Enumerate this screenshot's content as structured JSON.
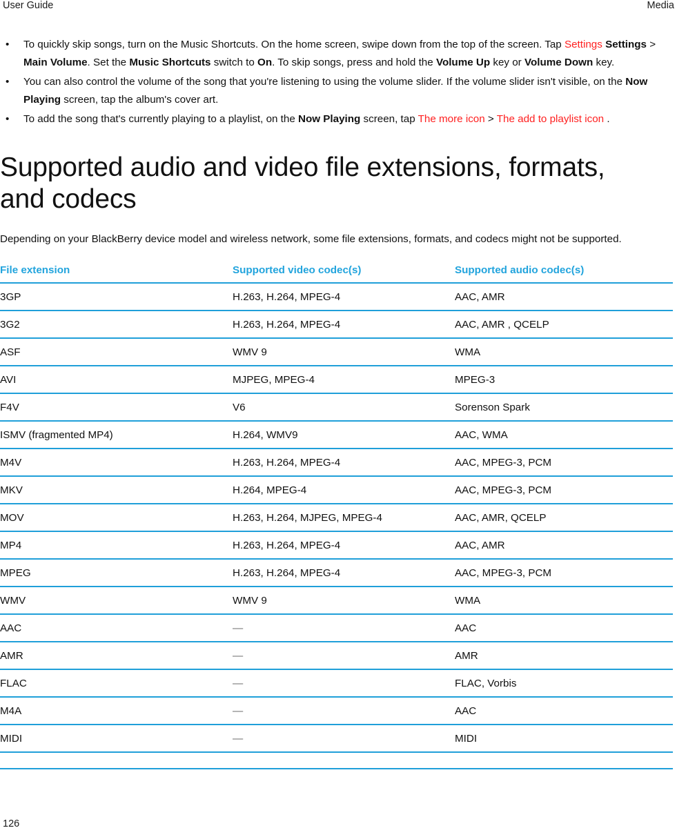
{
  "header": {
    "left": "User Guide",
    "right": "Media"
  },
  "bullets": [
    {
      "segments": [
        {
          "text": "To quickly skip songs, turn on the Music Shortcuts. On the home screen, swipe down from the top of the screen. Tap ",
          "style": "normal"
        },
        {
          "text": "Settings",
          "style": "icon-placeholder"
        },
        {
          "text": " ",
          "style": "normal"
        },
        {
          "text": "Settings",
          "style": "bold"
        },
        {
          "text": " > ",
          "style": "normal"
        },
        {
          "text": "Main Volume",
          "style": "bold"
        },
        {
          "text": ". Set the ",
          "style": "normal"
        },
        {
          "text": "Music Shortcuts",
          "style": "bold"
        },
        {
          "text": " switch to ",
          "style": "normal"
        },
        {
          "text": "On",
          "style": "bold"
        },
        {
          "text": ". To skip songs, press and hold the ",
          "style": "normal"
        },
        {
          "text": "Volume Up",
          "style": "bold"
        },
        {
          "text": " key or ",
          "style": "normal"
        },
        {
          "text": "Volume Down",
          "style": "bold"
        },
        {
          "text": " key.",
          "style": "normal"
        }
      ]
    },
    {
      "segments": [
        {
          "text": "You can also control the volume of the song that you're listening to using the volume slider. If the volume slider isn't visible, on the ",
          "style": "normal"
        },
        {
          "text": "Now Playing",
          "style": "bold"
        },
        {
          "text": " screen, tap the album's cover art.",
          "style": "normal"
        }
      ]
    },
    {
      "segments": [
        {
          "text": "To add the song that's currently playing to a playlist, on the ",
          "style": "normal"
        },
        {
          "text": "Now Playing",
          "style": "bold"
        },
        {
          "text": " screen, tap ",
          "style": "normal"
        },
        {
          "text": " The more icon ",
          "style": "icon-placeholder"
        },
        {
          "text": " > ",
          "style": "normal"
        },
        {
          "text": " The add to playlist icon ",
          "style": "icon-placeholder"
        },
        {
          "text": ".",
          "style": "normal"
        }
      ]
    }
  ],
  "section": {
    "title": "Supported audio and video file extensions, formats, and codecs",
    "intro": "Depending on your BlackBerry device model and wireless network, some file extensions, formats, and codecs might not be supported."
  },
  "table": {
    "columns": [
      "File extension",
      "Supported video codec(s)",
      "Supported audio codec(s)"
    ],
    "rows": [
      {
        "extension": "3GP",
        "video": "H.263, H.264, MPEG-4",
        "audio": "AAC, AMR",
        "video_is_dash": false
      },
      {
        "extension": "3G2",
        "video": "H.263, H.264, MPEG-4",
        "audio": "AAC, AMR , QCELP",
        "video_is_dash": false
      },
      {
        "extension": "ASF",
        "video": "WMV 9",
        "audio": "WMA",
        "video_is_dash": false
      },
      {
        "extension": "AVI",
        "video": "MJPEG, MPEG-4",
        "audio": "MPEG-3",
        "video_is_dash": false
      },
      {
        "extension": "F4V",
        "video": "V6",
        "audio": "Sorenson Spark",
        "video_is_dash": false
      },
      {
        "extension": "ISMV (fragmented MP4)",
        "video": "H.264, WMV9",
        "audio": "AAC, WMA",
        "video_is_dash": false
      },
      {
        "extension": "M4V",
        "video": "H.263, H.264, MPEG-4",
        "audio": "AAC, MPEG-3, PCM",
        "video_is_dash": false
      },
      {
        "extension": "MKV",
        "video": "H.264, MPEG-4",
        "audio": "AAC, MPEG-3, PCM",
        "video_is_dash": false
      },
      {
        "extension": "MOV",
        "video": "H.263, H.264, MJPEG, MPEG-4",
        "audio": "AAC, AMR, QCELP",
        "video_is_dash": false
      },
      {
        "extension": "MP4",
        "video": "H.263, H.264, MPEG-4",
        "audio": "AAC, AMR",
        "video_is_dash": false
      },
      {
        "extension": "MPEG",
        "video": "H.263, H.264, MPEG-4",
        "audio": "AAC, MPEG-3, PCM",
        "video_is_dash": false
      },
      {
        "extension": "WMV",
        "video": "WMV 9",
        "audio": "WMA",
        "video_is_dash": false
      },
      {
        "extension": "AAC",
        "video": "—",
        "audio": "AAC",
        "video_is_dash": true
      },
      {
        "extension": "AMR",
        "video": "—",
        "audio": "AMR",
        "video_is_dash": true
      },
      {
        "extension": "FLAC",
        "video": "—",
        "audio": "FLAC, Vorbis",
        "video_is_dash": true
      },
      {
        "extension": "M4A",
        "video": "—",
        "audio": "AAC",
        "video_is_dash": true
      },
      {
        "extension": "MIDI",
        "video": "—",
        "audio": "MIDI",
        "video_is_dash": true
      }
    ]
  },
  "footer": {
    "page_number": "126"
  },
  "colors": {
    "accent": "#1f9fd9",
    "header_text": "#22a4dd",
    "icon_placeholder": "#ff2020",
    "dash": "#6b6b6b",
    "body_text": "#111111"
  }
}
